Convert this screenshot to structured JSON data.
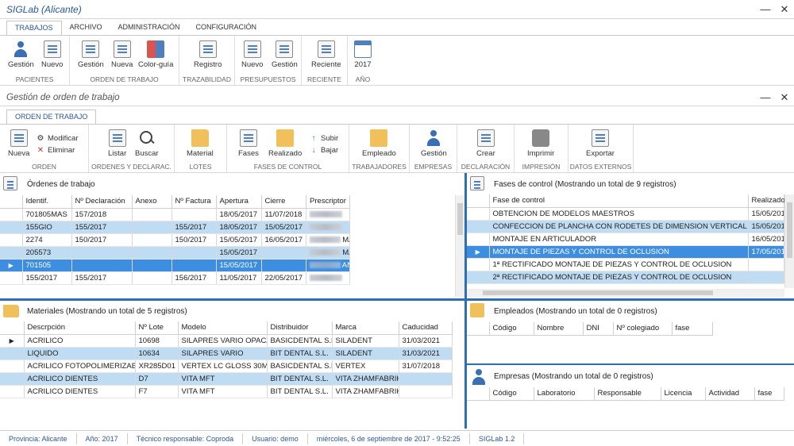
{
  "app": {
    "title": "SIGLab (Alicante)"
  },
  "main_tabs": [
    {
      "label": "TRABAJOS"
    },
    {
      "label": "ARCHIVO"
    },
    {
      "label": "ADMINISTRACIÓN"
    },
    {
      "label": "CONFIGURACIÓN"
    }
  ],
  "main_ribbon": {
    "groups": [
      {
        "label": "PACIENTES",
        "buttons": [
          "Gestión",
          "Nuevo"
        ]
      },
      {
        "label": "ORDEN DE TRABAJO",
        "buttons": [
          "Gestión",
          "Nueva",
          "Color-guía"
        ]
      },
      {
        "label": "TRAZABILIDAD",
        "buttons": [
          "Registro"
        ]
      },
      {
        "label": "PRESUPUESTOS",
        "buttons": [
          "Nuevo",
          "Gestión"
        ]
      },
      {
        "label": "RECIENTE",
        "buttons": [
          "Reciente"
        ]
      },
      {
        "label": "AÑO",
        "buttons": [
          "2017"
        ]
      }
    ]
  },
  "child_window": {
    "title": "Gestión de orden de trabajo",
    "tab": "ORDEN DE TRABAJO"
  },
  "child_ribbon": {
    "orden": {
      "label": "ORDEN",
      "nueva": "Nueva",
      "modificar": "Modificar",
      "eliminar": "Eliminar"
    },
    "ordenes": {
      "label": "ORDENES Y DECLARAC.",
      "listar": "Listar",
      "buscar": "Buscar"
    },
    "lotes": {
      "label": "LOTES",
      "material": "Material"
    },
    "fases": {
      "label": "FASES DE CONTROL",
      "fases": "Fases",
      "realizado": "Realizado",
      "subir": "Subir",
      "bajar": "Bajar"
    },
    "trabajadores": {
      "label": "TRABAJADORES",
      "empleado": "Empleado"
    },
    "empresas": {
      "label": "EMPRESAS",
      "gestion": "Gestión"
    },
    "declaracion": {
      "label": "DECLARACIÓN",
      "crear": "Crear"
    },
    "impresion": {
      "label": "IMPRESIÓN",
      "imprimir": "Imprimir"
    },
    "externos": {
      "label": "DATOS EXTERNOS",
      "exportar": "Exportar"
    }
  },
  "ordenes": {
    "title": "Órdenes de trabajo",
    "columns": [
      "Identif.",
      "Nº Declaración",
      "Anexo",
      "Nº Factura",
      "Apertura",
      "Cierre",
      "Prescriptor"
    ],
    "rows": [
      {
        "id": "701805MAS",
        "decl": "157/2018",
        "anexo": "",
        "factura": "",
        "apertura": "18/05/2017",
        "cierre": "11/07/2018",
        "presc": "",
        "suffix": ""
      },
      {
        "id": "155GIO",
        "decl": "155/2017",
        "anexo": "",
        "factura": "155/2017",
        "apertura": "18/05/2017",
        "cierre": "15/05/2017",
        "presc": "",
        "suffix": ""
      },
      {
        "id": "2274",
        "decl": "150/2017",
        "anexo": "",
        "factura": "150/2017",
        "apertura": "15/05/2017",
        "cierre": "16/05/2017",
        "presc": "",
        "suffix": "MAR"
      },
      {
        "id": "205573",
        "decl": "",
        "anexo": "",
        "factura": "",
        "apertura": "15/05/2017",
        "cierre": "",
        "presc": "",
        "suffix": "MAR"
      },
      {
        "id": "701505",
        "decl": "",
        "anexo": "",
        "factura": "",
        "apertura": "15/05/2017",
        "cierre": "",
        "presc": "",
        "suffix": "ANI"
      },
      {
        "id": "155/2017",
        "decl": "155/2017",
        "anexo": "",
        "factura": "156/2017",
        "apertura": "11/05/2017",
        "cierre": "22/05/2017",
        "presc": "",
        "suffix": ""
      }
    ]
  },
  "fases": {
    "title": "Fases de control (Mostrando un total de 9 registros)",
    "columns": [
      "Fase de control",
      "Realizado"
    ],
    "rows": [
      {
        "fase": "OBTENCION DE MODELOS MAESTROS",
        "real": "15/05/201"
      },
      {
        "fase": "CONFECCION DE PLANCHA CON RODETES DE DIMENSION VERTICAL",
        "real": "15/05/201"
      },
      {
        "fase": "MONTAJE EN ARTICULADOR",
        "real": "16/05/201"
      },
      {
        "fase": "MONTAJE DE PIEZAS Y CONTROL DE OCLUSION",
        "real": "17/05/201"
      },
      {
        "fase": "1ª RECTIFICADO MONTAJE DE PIEZAS Y CONTROL DE OCLUSION",
        "real": ""
      },
      {
        "fase": "2ª RECTIFICADO MONTAJE DE PIEZAS Y CONTROL DE OCLUSION",
        "real": ""
      }
    ]
  },
  "materiales": {
    "title": "Materiales (Mostrando un total de 5 registros)",
    "columns": [
      "Descrpción",
      "Nº Lote",
      "Modelo",
      "Distribuidor",
      "Marca",
      "Caducidad"
    ],
    "rows": [
      {
        "desc": "ACRILICO",
        "lote": "10698",
        "modelo": "SILAPRES VARIO OPACA",
        "dist": "BASICDENTAL S.L.",
        "marca": "SILADENT",
        "cad": "31/03/2021"
      },
      {
        "desc": "LIQUIDO",
        "lote": "10634",
        "modelo": "SILAPRES VARIO",
        "dist": "BIT DENTAL S.L.",
        "marca": "SILADENT",
        "cad": "31/03/2021"
      },
      {
        "desc": "ACRILICO FOTOPOLIMERIZABLE",
        "lote": "XR285D01",
        "modelo": "VERTEX LC GLOSS 30ML",
        "dist": "BASICDENTAL S.L.",
        "marca": "VERTEX",
        "cad": "31/07/2018"
      },
      {
        "desc": "ACRILICO DIENTES",
        "lote": "D7",
        "modelo": "VITA MFT",
        "dist": "BIT DENTAL S.L.",
        "marca": "VITA ZHAMFABRIK",
        "cad": ""
      },
      {
        "desc": "ACRILICO DIENTES",
        "lote": "F7",
        "modelo": "VITA MFT",
        "dist": "BIT DENTAL S.L.",
        "marca": "VITA ZHAMFABRIK",
        "cad": ""
      }
    ]
  },
  "empleados": {
    "title": "Empleados (Mostrando un total de 0 registros)",
    "columns": [
      "Código",
      "Nombre",
      "DNI",
      "Nº colegiado",
      "fase"
    ]
  },
  "empresas": {
    "title": "Empresas (Mostrando un total de 0 registros)",
    "columns": [
      "Código",
      "Laboratorio",
      "Responsable",
      "Licencia",
      "Actividad",
      "fase"
    ]
  },
  "status": {
    "provincia": "Provincia: Alicante",
    "anio": "Año: 2017",
    "tecnico": "Técnico responsable: Coproda",
    "usuario": "Usuario: demo",
    "fecha": "miércoles, 6 de septiembre de 2017 - 9:52:25",
    "version": "SIGLab 1.2"
  },
  "colors": {
    "accent": "#2b579a",
    "row_alt": "#bfdcf3",
    "row_selected": "#3d8ee0"
  }
}
